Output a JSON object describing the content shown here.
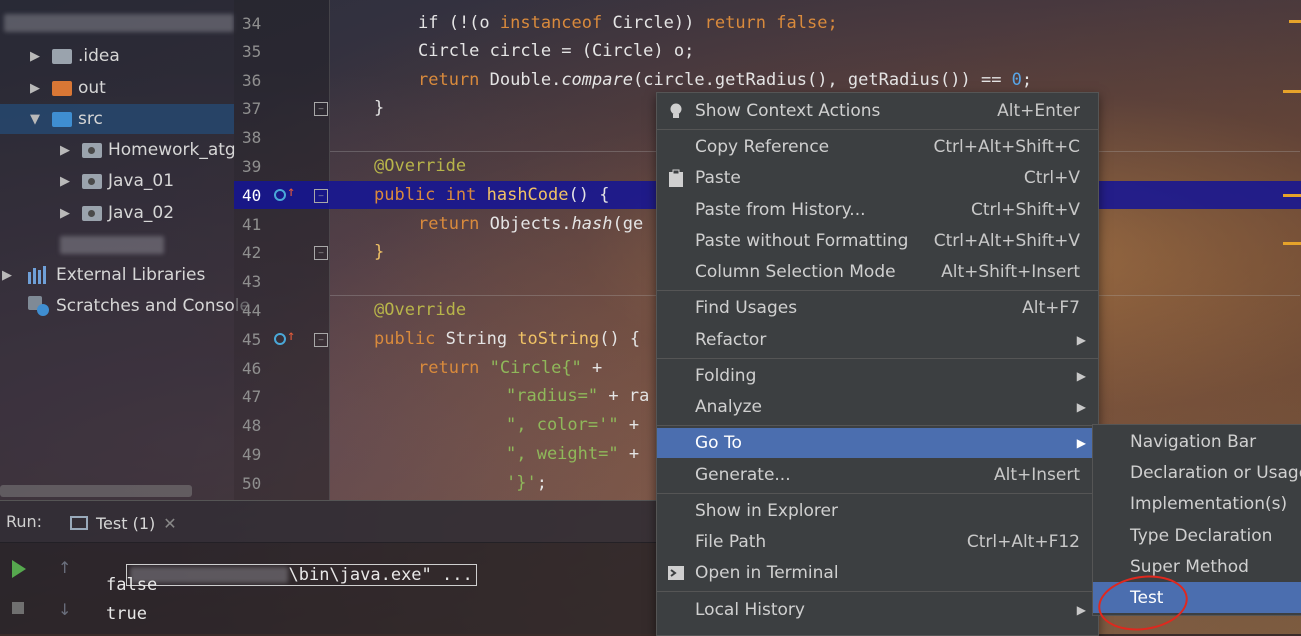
{
  "project_tree": {
    "items": [
      {
        "label": ".idea",
        "icon": "folder-icon"
      },
      {
        "label": "out",
        "icon": "folder-icon"
      },
      {
        "label": "src",
        "icon": "folder-icon"
      },
      {
        "label": "Homework_atg",
        "icon": "package-folder-icon"
      },
      {
        "label": "Java_01",
        "icon": "package-folder-icon"
      },
      {
        "label": "Java_02",
        "icon": "package-folder-icon"
      },
      {
        "label": "External Libraries",
        "icon": "libraries-icon"
      },
      {
        "label": "Scratches and Console",
        "icon": "scratches-icon"
      }
    ]
  },
  "editor": {
    "lines": [
      {
        "n": "34"
      },
      {
        "n": "35"
      },
      {
        "n": "36"
      },
      {
        "n": "37"
      },
      {
        "n": "38"
      },
      {
        "n": "39"
      },
      {
        "n": "40"
      },
      {
        "n": "41"
      },
      {
        "n": "42"
      },
      {
        "n": "43"
      },
      {
        "n": "44"
      },
      {
        "n": "45"
      },
      {
        "n": "46"
      },
      {
        "n": "47"
      },
      {
        "n": "48"
      },
      {
        "n": "49"
      },
      {
        "n": "50"
      }
    ],
    "code": {
      "l34": [
        "if (!(o ",
        "instanceof",
        " Circle)) ",
        "return false",
        ";"
      ],
      "l35": "Circle circle = (Circle) o;",
      "l36": [
        "return",
        " Double.",
        "compare",
        "(circle.getRadius(), getRadius()) == ",
        "0",
        ";"
      ],
      "l37": "}",
      "l39": "@Override",
      "l40": [
        "public int",
        " ",
        "hashCode",
        "() {"
      ],
      "l41": [
        "return",
        " Objects.",
        "hash",
        "(ge"
      ],
      "l42": "}",
      "l44": "@Override",
      "l45": [
        "public",
        " String ",
        "toString",
        "() {"
      ],
      "l46": [
        "return",
        " ",
        "\"Circle{\"",
        " +"
      ],
      "l47": [
        "\"radius=\"",
        " + ra"
      ],
      "l48": [
        "\", color='\"",
        " +"
      ],
      "l49": [
        "\", weight=\"",
        " +"
      ],
      "l50": [
        "'}'",
        ";"
      ]
    }
  },
  "run_panel": {
    "label": "Run:",
    "tab": "Test (1)",
    "console": [
      "\\bin\\java.exe\" ...",
      "false",
      "true"
    ]
  },
  "context_menu": {
    "items": [
      {
        "label": "Show Context Actions",
        "shortcut": "Alt+Enter"
      },
      {
        "label": "Copy Reference",
        "shortcut": "Ctrl+Alt+Shift+C"
      },
      {
        "label": "Paste",
        "shortcut": "Ctrl+V"
      },
      {
        "label": "Paste from History...",
        "shortcut": "Ctrl+Shift+V"
      },
      {
        "label": "Paste without Formatting",
        "shortcut": "Ctrl+Alt+Shift+V"
      },
      {
        "label": "Column Selection Mode",
        "shortcut": "Alt+Shift+Insert"
      },
      {
        "label": "Find Usages",
        "shortcut": "Alt+F7"
      },
      {
        "label": "Refactor",
        "shortcut": ""
      },
      {
        "label": "Folding",
        "shortcut": ""
      },
      {
        "label": "Analyze",
        "shortcut": ""
      },
      {
        "label": "Go To",
        "shortcut": ""
      },
      {
        "label": "Generate...",
        "shortcut": "Alt+Insert"
      },
      {
        "label": "Show in Explorer",
        "shortcut": ""
      },
      {
        "label": "File Path",
        "shortcut": "Ctrl+Alt+F12"
      },
      {
        "label": "Open in Terminal",
        "shortcut": ""
      },
      {
        "label": "Local History",
        "shortcut": ""
      }
    ]
  },
  "goto_submenu": {
    "items": [
      {
        "label": "Navigation Bar"
      },
      {
        "label": "Declaration or Usages"
      },
      {
        "label": "Implementation(s)"
      },
      {
        "label": "Type Declaration"
      },
      {
        "label": "Super Method"
      },
      {
        "label": "Test"
      }
    ]
  },
  "colors": {
    "menu_bg": "#3c3f41",
    "menu_highlight": "#4b6eaf",
    "current_line": "#141496",
    "annotation_circle": "#e0281e"
  }
}
